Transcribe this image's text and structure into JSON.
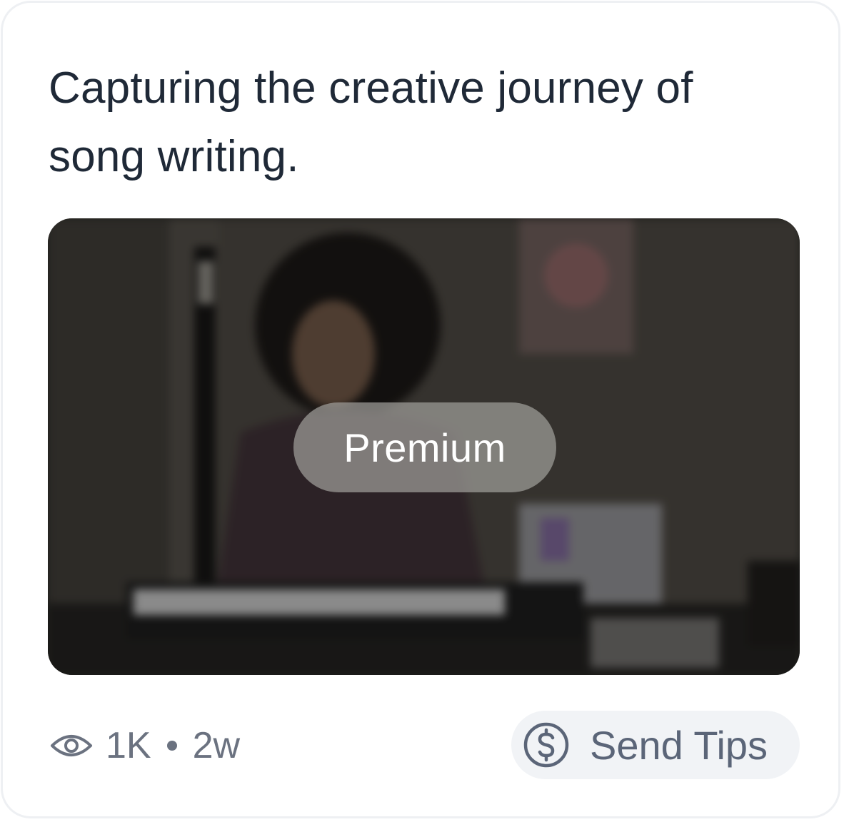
{
  "post": {
    "text": "Capturing the creative journey of song writing."
  },
  "media": {
    "badge_label": "Premium",
    "description_icon": "blurred-photo"
  },
  "stats": {
    "icon": "eye-icon",
    "views": "1K",
    "age": "2w"
  },
  "actions": {
    "tips_icon": "dollar-circle-icon",
    "tips_label": "Send Tips"
  },
  "colors": {
    "text": "#1f2937",
    "muted": "#6b7280",
    "badge_bg": "#a09e9a",
    "button_bg": "#f1f3f6"
  }
}
